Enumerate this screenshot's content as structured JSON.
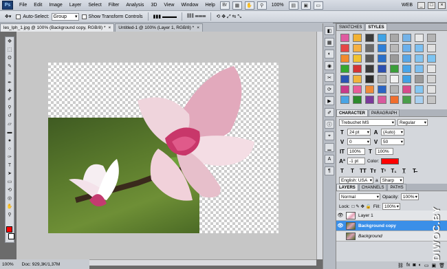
{
  "menubar": {
    "logo": "Ps",
    "items": [
      "File",
      "Edit",
      "Image",
      "Layer",
      "Select",
      "Filter",
      "Analysis",
      "3D",
      "View",
      "Window",
      "Help"
    ],
    "zoom": "100%",
    "workspace": "WEB"
  },
  "options": {
    "auto_select_label": "Auto-Select:",
    "auto_select_value": "Group",
    "transform_label": "Show Transform Controls"
  },
  "tabs": [
    {
      "title": "les_lph_1.jpg @ 100% (Background copy, RGB/8) *",
      "close": "×"
    },
    {
      "title": "Untitled-1 @ 100% (Layer 1, RGB/8) *",
      "close": "×"
    }
  ],
  "statusbar": {
    "zoom": "100%",
    "doc": "Doc: 929,3K/1,37M"
  },
  "styles_panel": {
    "tabs": [
      "SWATCHES",
      "STYLES"
    ],
    "swatch_colors": [
      "#e05aa0",
      "#f2b234",
      "#3b3b3b",
      "#3fa3e6",
      "#a8a8a8",
      "#74b3e8",
      "#e8e8e8",
      "#b4b4b4",
      "#e64646",
      "#f5b042",
      "#6b6b6b",
      "#2e7fd8",
      "#b8b8b8",
      "#6bb0ec",
      "#7cc0f2",
      "#e0e0e0",
      "#f28a2e",
      "#f2c230",
      "#5a5a5a",
      "#2a6fc9",
      "#9a9a9a",
      "#58a6e6",
      "#82c3f0",
      "#7dc4f2",
      "#34a830",
      "#d43434",
      "#3b3b3b",
      "#2c4fb0",
      "#3a9e3a",
      "#48a4e8",
      "#7cbff0",
      "#e6e6e6",
      "#2a55b4",
      "#f0b43c",
      "#2b2b2b",
      "#b0b0b0",
      "#f2f2f2",
      "#3fa0e4",
      "#9a9a9a",
      "#d4d4d4",
      "#c83a8a",
      "#e85c9a",
      "#ee8a3a",
      "#2a64c4",
      "#b4b4b4",
      "#d64a8c",
      "#84c6f2",
      "#e2e2e2",
      "#4aa4e4",
      "#2d8a2d",
      "#7a3a9a",
      "#d85a9e",
      "#f06e2e",
      "#4a9e4a",
      "#a8d0f0",
      "#c4c4c4"
    ]
  },
  "character": {
    "tabs": [
      "CHARACTER",
      "PARAGRAPH"
    ],
    "font": "Trebuchet MS",
    "style": "Regular",
    "size": "24 pt",
    "leading": "(Auto)",
    "kerning": "0",
    "tracking": "50",
    "vscale": "100%",
    "hscale": "100%",
    "baseline": "-1 pt",
    "color_label": "Color:",
    "color": "#ff0000",
    "language": "English: USA",
    "aa_label": "a",
    "aa": "Sharp"
  },
  "layers": {
    "tabs": [
      "LAYERS",
      "CHANNELS",
      "PATHS"
    ],
    "blend": "Normal",
    "opacity_label": "Opacity:",
    "opacity": "100%",
    "lock_label": "Lock:",
    "fill_label": "Fill:",
    "fill": "100%",
    "items": [
      {
        "name": "Layer 1"
      },
      {
        "name": "Background copy"
      },
      {
        "name": "Background"
      }
    ]
  },
  "watermark": "DIWOC.BY"
}
